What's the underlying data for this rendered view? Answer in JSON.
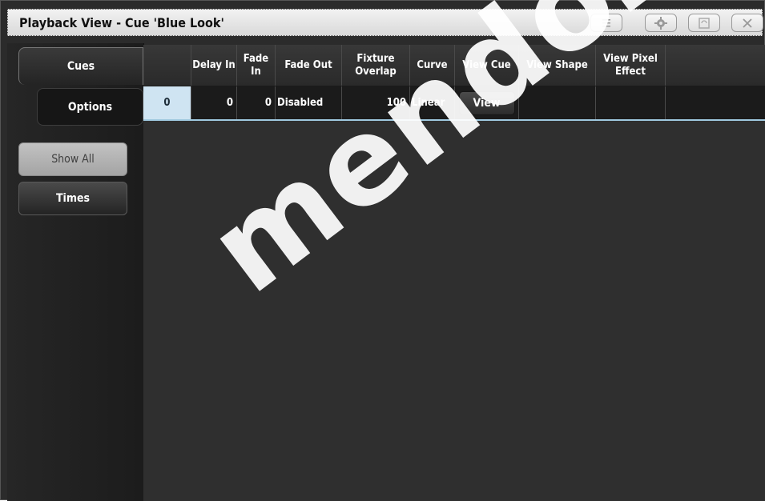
{
  "window": {
    "title": "Playback View - Cue 'Blue Look'",
    "title_buttons": [
      {
        "icon": "menu-icon"
      },
      {
        "icon": "gear-icon"
      },
      {
        "icon": "undock-icon"
      },
      {
        "icon": "close-icon"
      }
    ]
  },
  "sidebar": {
    "tab_cues": "Cues",
    "tab_options": "Options",
    "btn_show_all": "Show All",
    "btn_times": "Times"
  },
  "table": {
    "columns": [
      "",
      "Delay In",
      "Fade In",
      "Fade Out",
      "Fixture Overlap",
      "Curve",
      "View Cue",
      "View Shape",
      "View Pixel Effect"
    ],
    "rows": [
      {
        "number": "0",
        "delay_in": "0",
        "fade_in": "0",
        "fade_out": "Disabled",
        "fixture_overlap": "100",
        "curve": "Linear",
        "view_cue": "View",
        "view_shape": "",
        "view_pixel_effect": ""
      }
    ]
  },
  "watermark": "mendoza.co",
  "colors": {
    "selected_cell": "#cfe4f2",
    "row_underline": "#9fc9e0",
    "background": "#2b2b2b"
  }
}
